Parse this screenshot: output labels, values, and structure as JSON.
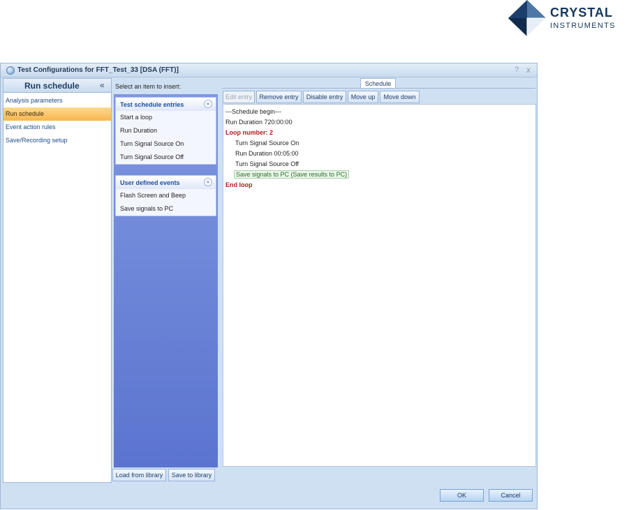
{
  "logo": {
    "name": "CRYSTAL",
    "sub": "INSTRUMENTS"
  },
  "window": {
    "title": "Test Configurations for FFT_Test_33 [DSA (FFT)]",
    "help": "?",
    "close": "x"
  },
  "left_panel": {
    "title": "Run schedule",
    "collapse": "«",
    "items": [
      {
        "label": "Analysis parameters",
        "active": false
      },
      {
        "label": "Run schedule",
        "active": true
      },
      {
        "label": "Event action rules",
        "active": false
      },
      {
        "label": "Save/Recording setup",
        "active": false
      }
    ]
  },
  "middle": {
    "prompt": "Select an item to insert:",
    "groups": [
      {
        "title": "Test schedule entries",
        "items": [
          "Start a loop",
          "Run Duration",
          "Turn Signal Source On",
          "Turn Signal Source Off"
        ]
      },
      {
        "title": "User defined events",
        "items": [
          "Flash Screen and Beep",
          "Save signals to PC"
        ]
      }
    ],
    "chevron": "«",
    "load_library": "Load from library",
    "save_library": "Save to library"
  },
  "schedule": {
    "tab": "Schedule",
    "toolbar": {
      "edit": "Edit entry",
      "remove": "Remove entry",
      "disable": "Disable entry",
      "move_up": "Move up",
      "move_down": "Move down"
    },
    "entries": [
      "---Schedule begin---",
      "Run Duration 720:00:00",
      "Loop number: 2",
      "Turn Signal Source On",
      "Run Duration 00:05:00",
      "Turn Signal Source Off",
      "Save signals to PC (Save results to PC)",
      "End loop"
    ]
  },
  "buttons": {
    "ok": "OK",
    "cancel": "Cancel"
  },
  "colors": {
    "accent": "#f7b54d",
    "loop_text": "#b01d1d",
    "panel_blue": "#6a82d6"
  }
}
